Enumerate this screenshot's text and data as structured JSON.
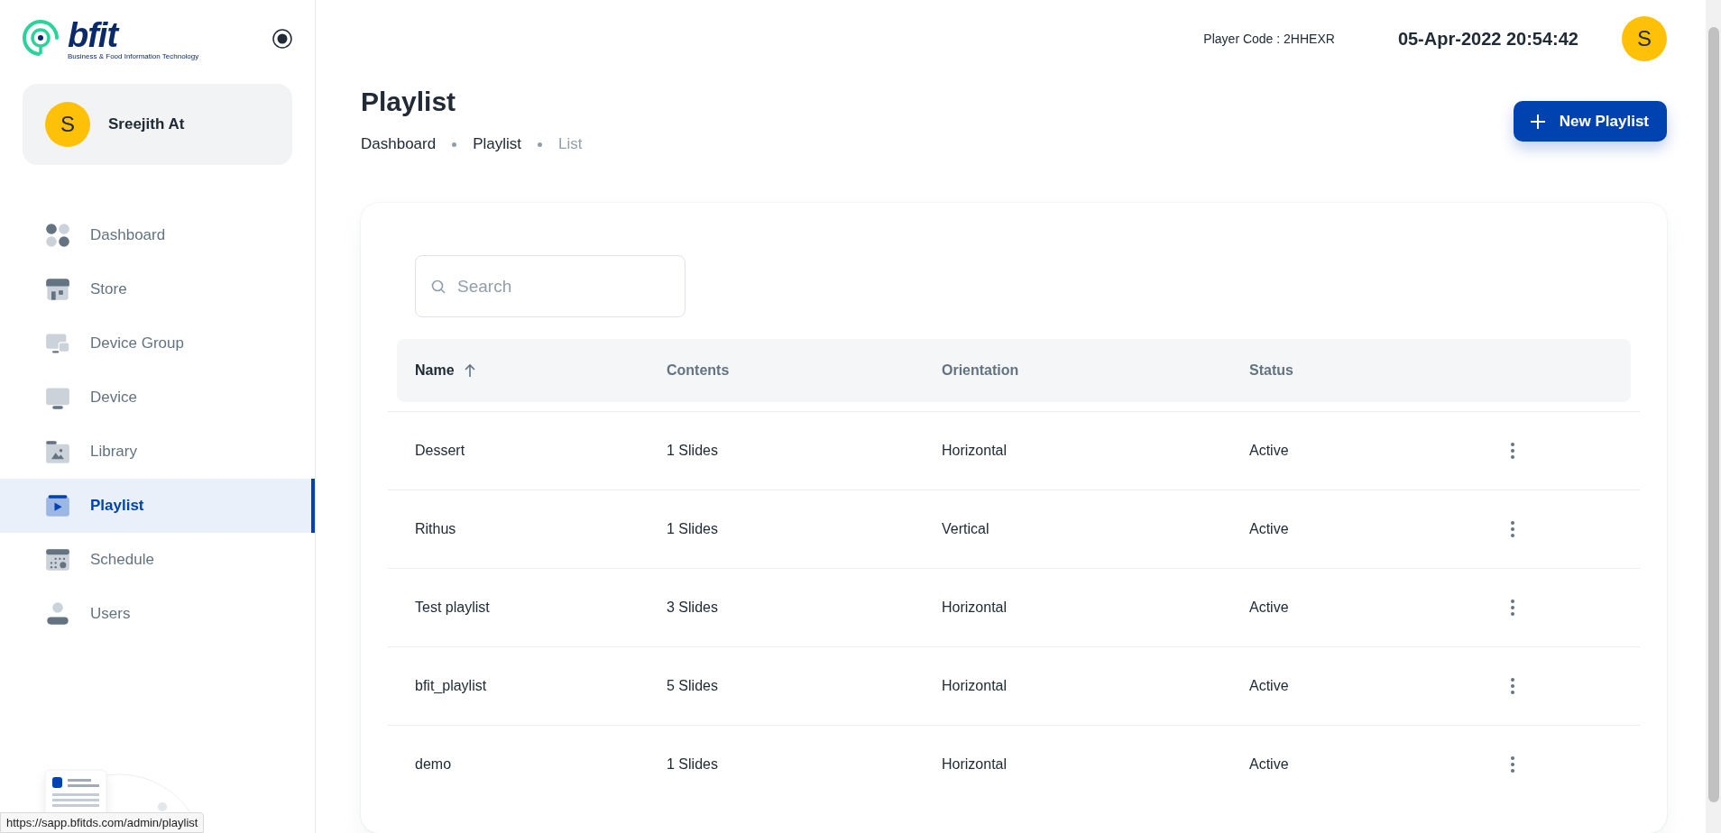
{
  "logo": {
    "text": "bfit",
    "tagline": "Business & Food Information Technology"
  },
  "profile": {
    "initial": "S",
    "name": "Sreejith At"
  },
  "sidebar": {
    "items": [
      {
        "label": "Dashboard",
        "kind": "dashboard",
        "selected": false
      },
      {
        "label": "Store",
        "kind": "store",
        "selected": false
      },
      {
        "label": "Device Group",
        "kind": "devicegroup",
        "selected": false
      },
      {
        "label": "Device",
        "kind": "device",
        "selected": false
      },
      {
        "label": "Library",
        "kind": "library",
        "selected": false
      },
      {
        "label": "Playlist",
        "kind": "playlist",
        "selected": true
      },
      {
        "label": "Schedule",
        "kind": "schedule",
        "selected": false
      },
      {
        "label": "Users",
        "kind": "users",
        "selected": false
      }
    ]
  },
  "header": {
    "player_code": "Player Code : 2HHEXR",
    "datetime": "05-Apr-2022 20:54:42",
    "avatar_initial": "S"
  },
  "page": {
    "title": "Playlist",
    "breadcrumb": [
      "Dashboard",
      "Playlist",
      "List"
    ],
    "new_button": "New Playlist"
  },
  "search": {
    "placeholder": "Search"
  },
  "table": {
    "columns": [
      {
        "label": "Name",
        "sorted": true
      },
      {
        "label": "Contents",
        "sorted": false
      },
      {
        "label": "Orientation",
        "sorted": false
      },
      {
        "label": "Status",
        "sorted": false
      }
    ],
    "rows": [
      {
        "name": "Dessert",
        "contents": "1 Slides",
        "orientation": "Horizontal",
        "status": "Active"
      },
      {
        "name": "Rithus",
        "contents": "1 Slides",
        "orientation": "Vertical",
        "status": "Active"
      },
      {
        "name": "Test playlist",
        "contents": "3 Slides",
        "orientation": "Horizontal",
        "status": "Active"
      },
      {
        "name": "bfit_playlist",
        "contents": "5 Slides",
        "orientation": "Horizontal",
        "status": "Active"
      },
      {
        "name": "demo",
        "contents": "1 Slides",
        "orientation": "Horizontal",
        "status": "Active"
      }
    ]
  },
  "status_bar": {
    "url": "https://sapp.bfitds.com/admin/playlist"
  }
}
